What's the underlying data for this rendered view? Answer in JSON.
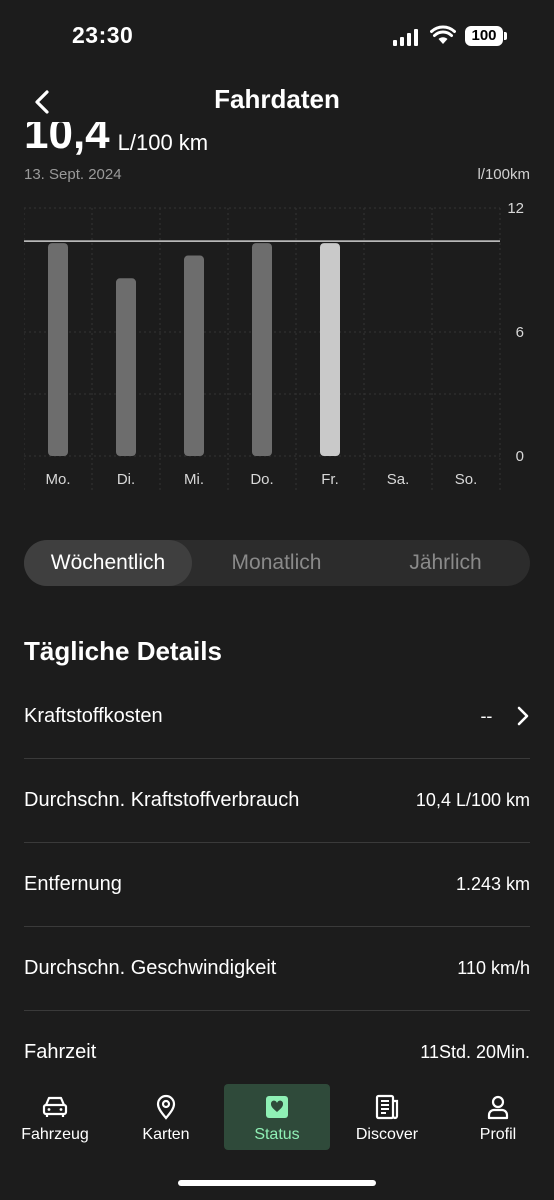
{
  "status_bar": {
    "time": "23:30",
    "battery": "100"
  },
  "header": {
    "title": "Fahrdaten"
  },
  "summary": {
    "value": "10,4",
    "unit": "L/100 km",
    "date": "13. Sept. 2024",
    "axis_unit": "l/100km"
  },
  "chart_data": {
    "type": "bar",
    "categories": [
      "Mo.",
      "Di.",
      "Mi.",
      "Do.",
      "Fr.",
      "Sa.",
      "So."
    ],
    "values": [
      10.3,
      8.6,
      9.7,
      10.3,
      10.3,
      null,
      null
    ],
    "highlight_index": 4,
    "reference_line": 10.4,
    "yticks": [
      0,
      6,
      12
    ],
    "ylim": [
      0,
      12
    ],
    "colors": {
      "bar": "#6d6d6d",
      "highlight": "#c9c9c9",
      "grid": "#333333",
      "ref": "#cfcfcf"
    }
  },
  "segments": {
    "weekly": "Wöchentlich",
    "monthly": "Monatlich",
    "yearly": "Jährlich"
  },
  "details": {
    "title": "Tägliche Details",
    "rows": [
      {
        "label": "Kraftstoffkosten",
        "value": "--"
      },
      {
        "label": "Durchschn. Kraftstoffverbrauch",
        "value": "10,4 L/100 km"
      },
      {
        "label": "Entfernung",
        "value": "1.243 km"
      },
      {
        "label": "Durchschn. Geschwindigkeit",
        "value": "110 km/h"
      },
      {
        "label": "Fahrzeit",
        "value": "11Std. 20Min."
      }
    ]
  },
  "tabbar": {
    "vehicle": "Fahrzeug",
    "maps": "Karten",
    "status": "Status",
    "discover": "Discover",
    "profile": "Profil"
  }
}
